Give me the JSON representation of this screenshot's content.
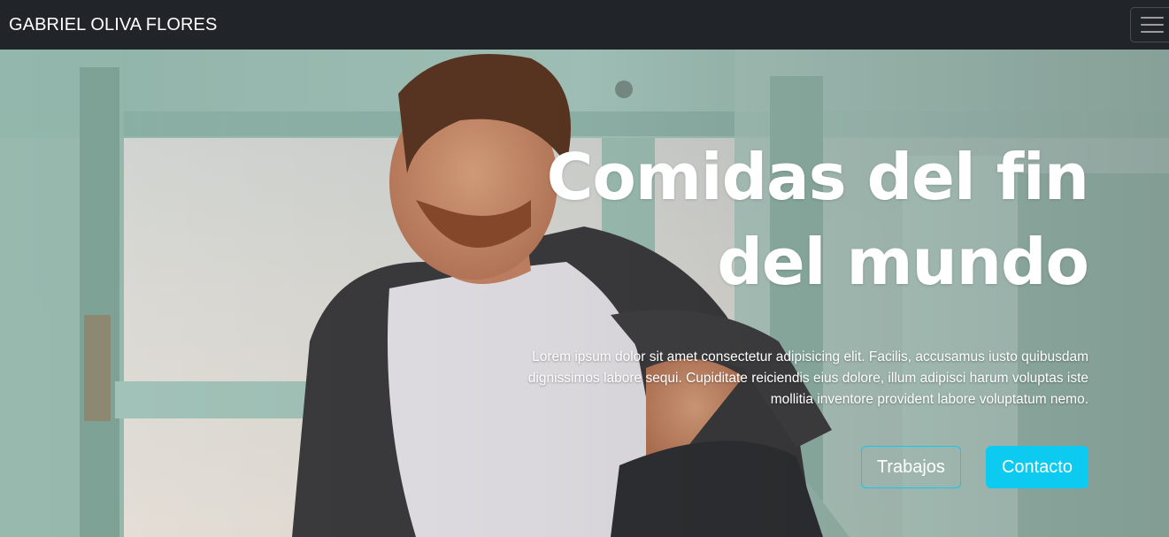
{
  "navbar": {
    "brand": "GABRIEL OLIVA FLORES",
    "toggler_icon": "hamburger-menu-icon"
  },
  "hero": {
    "title": "Comidas del fin del mundo",
    "text": "Lorem ipsum dolor sit amet consectetur adipisicing elit. Facilis, accusamus iusto quibusdam dignissimos labore sequi. Cupiditate reiciendis eius dolore, illum adipisci harum voluptas iste mollitia inventore provident labore voluptatum nemo.",
    "buttons": {
      "works_label": "Trabajos",
      "contact_label": "Contacto"
    }
  },
  "colors": {
    "navbar_bg": "#212529",
    "accent": "#0dcaf0",
    "text": "#ffffff"
  }
}
